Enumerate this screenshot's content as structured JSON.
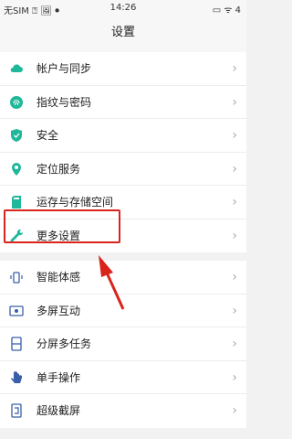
{
  "status_bar": {
    "carrier": "无SIM ⍰ 🖼 ⏺",
    "time": "14:26",
    "indicators": "▭ ᯤ 4"
  },
  "title": "设置",
  "group1": [
    {
      "label": "帐户与同步",
      "icon": "cloud-icon"
    },
    {
      "label": "指纹与密码",
      "icon": "fingerprint-icon"
    },
    {
      "label": "安全",
      "icon": "shield-icon"
    },
    {
      "label": "定位服务",
      "icon": "location-pin-icon"
    },
    {
      "label": "运存与存储空间",
      "icon": "storage-icon"
    },
    {
      "label": "更多设置",
      "icon": "wrench-icon"
    }
  ],
  "group2": [
    {
      "label": "智能体感",
      "icon": "motion-icon"
    },
    {
      "label": "多屏互动",
      "icon": "screen-cast-icon"
    },
    {
      "label": "分屏多任务",
      "icon": "split-screen-icon"
    },
    {
      "label": "单手操作",
      "icon": "hand-icon"
    },
    {
      "label": "超级截屏",
      "icon": "screenshot-icon"
    }
  ],
  "chevron": "›",
  "colors": {
    "accent": "#1fb89a",
    "highlight": "#d9241c"
  }
}
